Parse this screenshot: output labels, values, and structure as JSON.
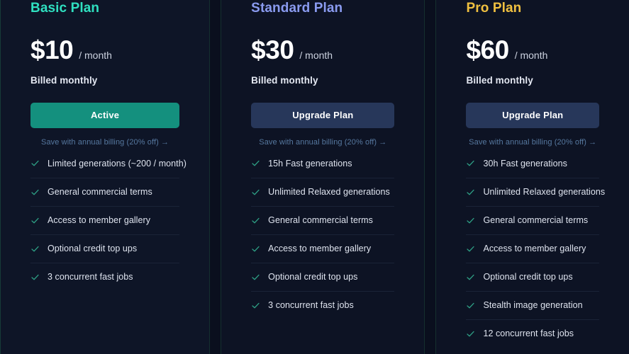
{
  "plans": [
    {
      "name": "Basic Plan",
      "name_color": "#2fe0c0",
      "price": "$10",
      "period": "/ month",
      "billing_note": "Billed monthly",
      "button_label": "Active",
      "button_state": "active",
      "annual_link": "Save with annual billing (20% off) →",
      "features": [
        "Limited generations (~200 / month)",
        "General commercial terms",
        "Access to member gallery",
        "Optional credit top ups",
        "3 concurrent fast jobs"
      ]
    },
    {
      "name": "Standard Plan",
      "name_color": "#8a9bf0",
      "price": "$30",
      "period": "/ month",
      "billing_note": "Billed monthly",
      "button_label": "Upgrade Plan",
      "button_state": "upgrade",
      "annual_link": "Save with annual billing (20% off) →",
      "features": [
        "15h Fast generations",
        "Unlimited Relaxed generations",
        "General commercial terms",
        "Access to member gallery",
        "Optional credit top ups",
        "3 concurrent fast jobs"
      ]
    },
    {
      "name": "Pro Plan",
      "name_color": "#f0c040",
      "price": "$60",
      "period": "/ month",
      "billing_note": "Billed monthly",
      "button_label": "Upgrade Plan",
      "button_state": "upgrade",
      "annual_link": "Save with annual billing (20% off) →",
      "features": [
        "30h Fast generations",
        "Unlimited Relaxed generations",
        "General commercial terms",
        "Access to member gallery",
        "Optional credit top ups",
        "Stealth image generation",
        "12 concurrent fast jobs"
      ]
    }
  ],
  "icons": {
    "check": "check-icon"
  },
  "colors": {
    "background": "#0a0f1e",
    "card_background": "#0d1324",
    "active_button": "#14907e",
    "upgrade_button": "#27375a",
    "link": "#56789f",
    "check": "#2e9e84"
  }
}
